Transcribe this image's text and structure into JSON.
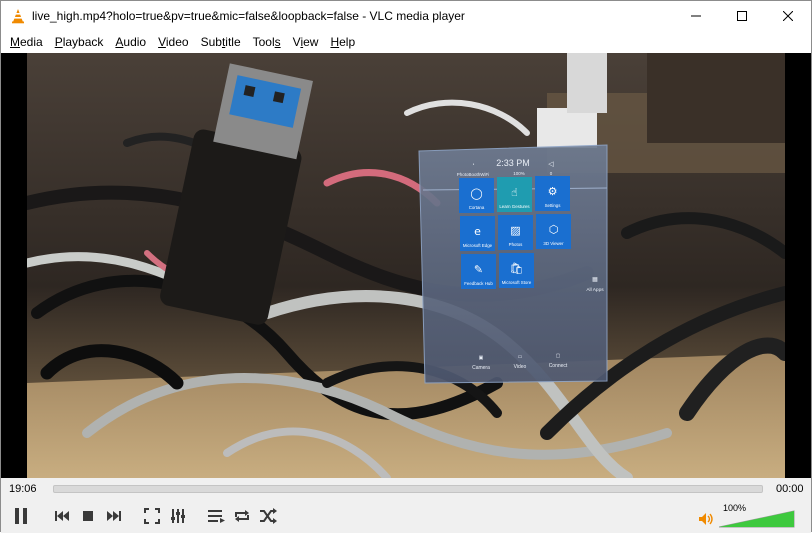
{
  "window": {
    "title": "live_high.mp4?holo=true&pv=true&mic=false&loopback=false - VLC media player"
  },
  "menu": {
    "items": [
      {
        "label": "Media",
        "accel": "M"
      },
      {
        "label": "Playback",
        "accel": "P"
      },
      {
        "label": "Audio",
        "accel": "A"
      },
      {
        "label": "Video",
        "accel": "V"
      },
      {
        "label": "Subtitle",
        "accel": "t"
      },
      {
        "label": "Tools",
        "accel": "s"
      },
      {
        "label": "View",
        "accel": "i"
      },
      {
        "label": "Help",
        "accel": "H"
      }
    ]
  },
  "holo": {
    "network": "PhotoBoothWiFi",
    "time": "2:33 PM",
    "battery": "100%",
    "volume": "0",
    "tiles": [
      {
        "label": "Cortana",
        "color": "#1a6fd0"
      },
      {
        "label": "Learn Gestures",
        "color": "#1f9cb0"
      },
      {
        "label": "Settings",
        "color": "#1a6fd0"
      },
      {
        "label": "Microsoft Edge",
        "color": "#1a6fd0"
      },
      {
        "label": "Photos",
        "color": "#1a6fd0"
      },
      {
        "label": "3D Viewer",
        "color": "#1a6fd0"
      },
      {
        "label": "Feedback Hub",
        "color": "#1a6fd0"
      },
      {
        "label": "Microsoft Store",
        "color": "#1a6fd0"
      }
    ],
    "all_apps": "All Apps",
    "bottom": {
      "camera": "Camera",
      "video": "Video",
      "connect": "Connect"
    }
  },
  "playback": {
    "elapsed": "19:06",
    "remaining": "00:00",
    "progress": 0
  },
  "volume": {
    "level_label": "100%",
    "level": 1.0
  },
  "colors": {
    "volume_fill": "#3ec93e",
    "vlc_orange": "#f08a00"
  },
  "icons": {
    "pause": "pause-icon",
    "prev": "previous-icon",
    "stop": "stop-icon",
    "next": "next-icon",
    "fullscreen": "fullscreen-icon",
    "extended": "extended-settings-icon",
    "playlist": "playlist-icon",
    "loop": "loop-icon",
    "shuffle": "shuffle-icon",
    "speaker": "speaker-icon"
  }
}
